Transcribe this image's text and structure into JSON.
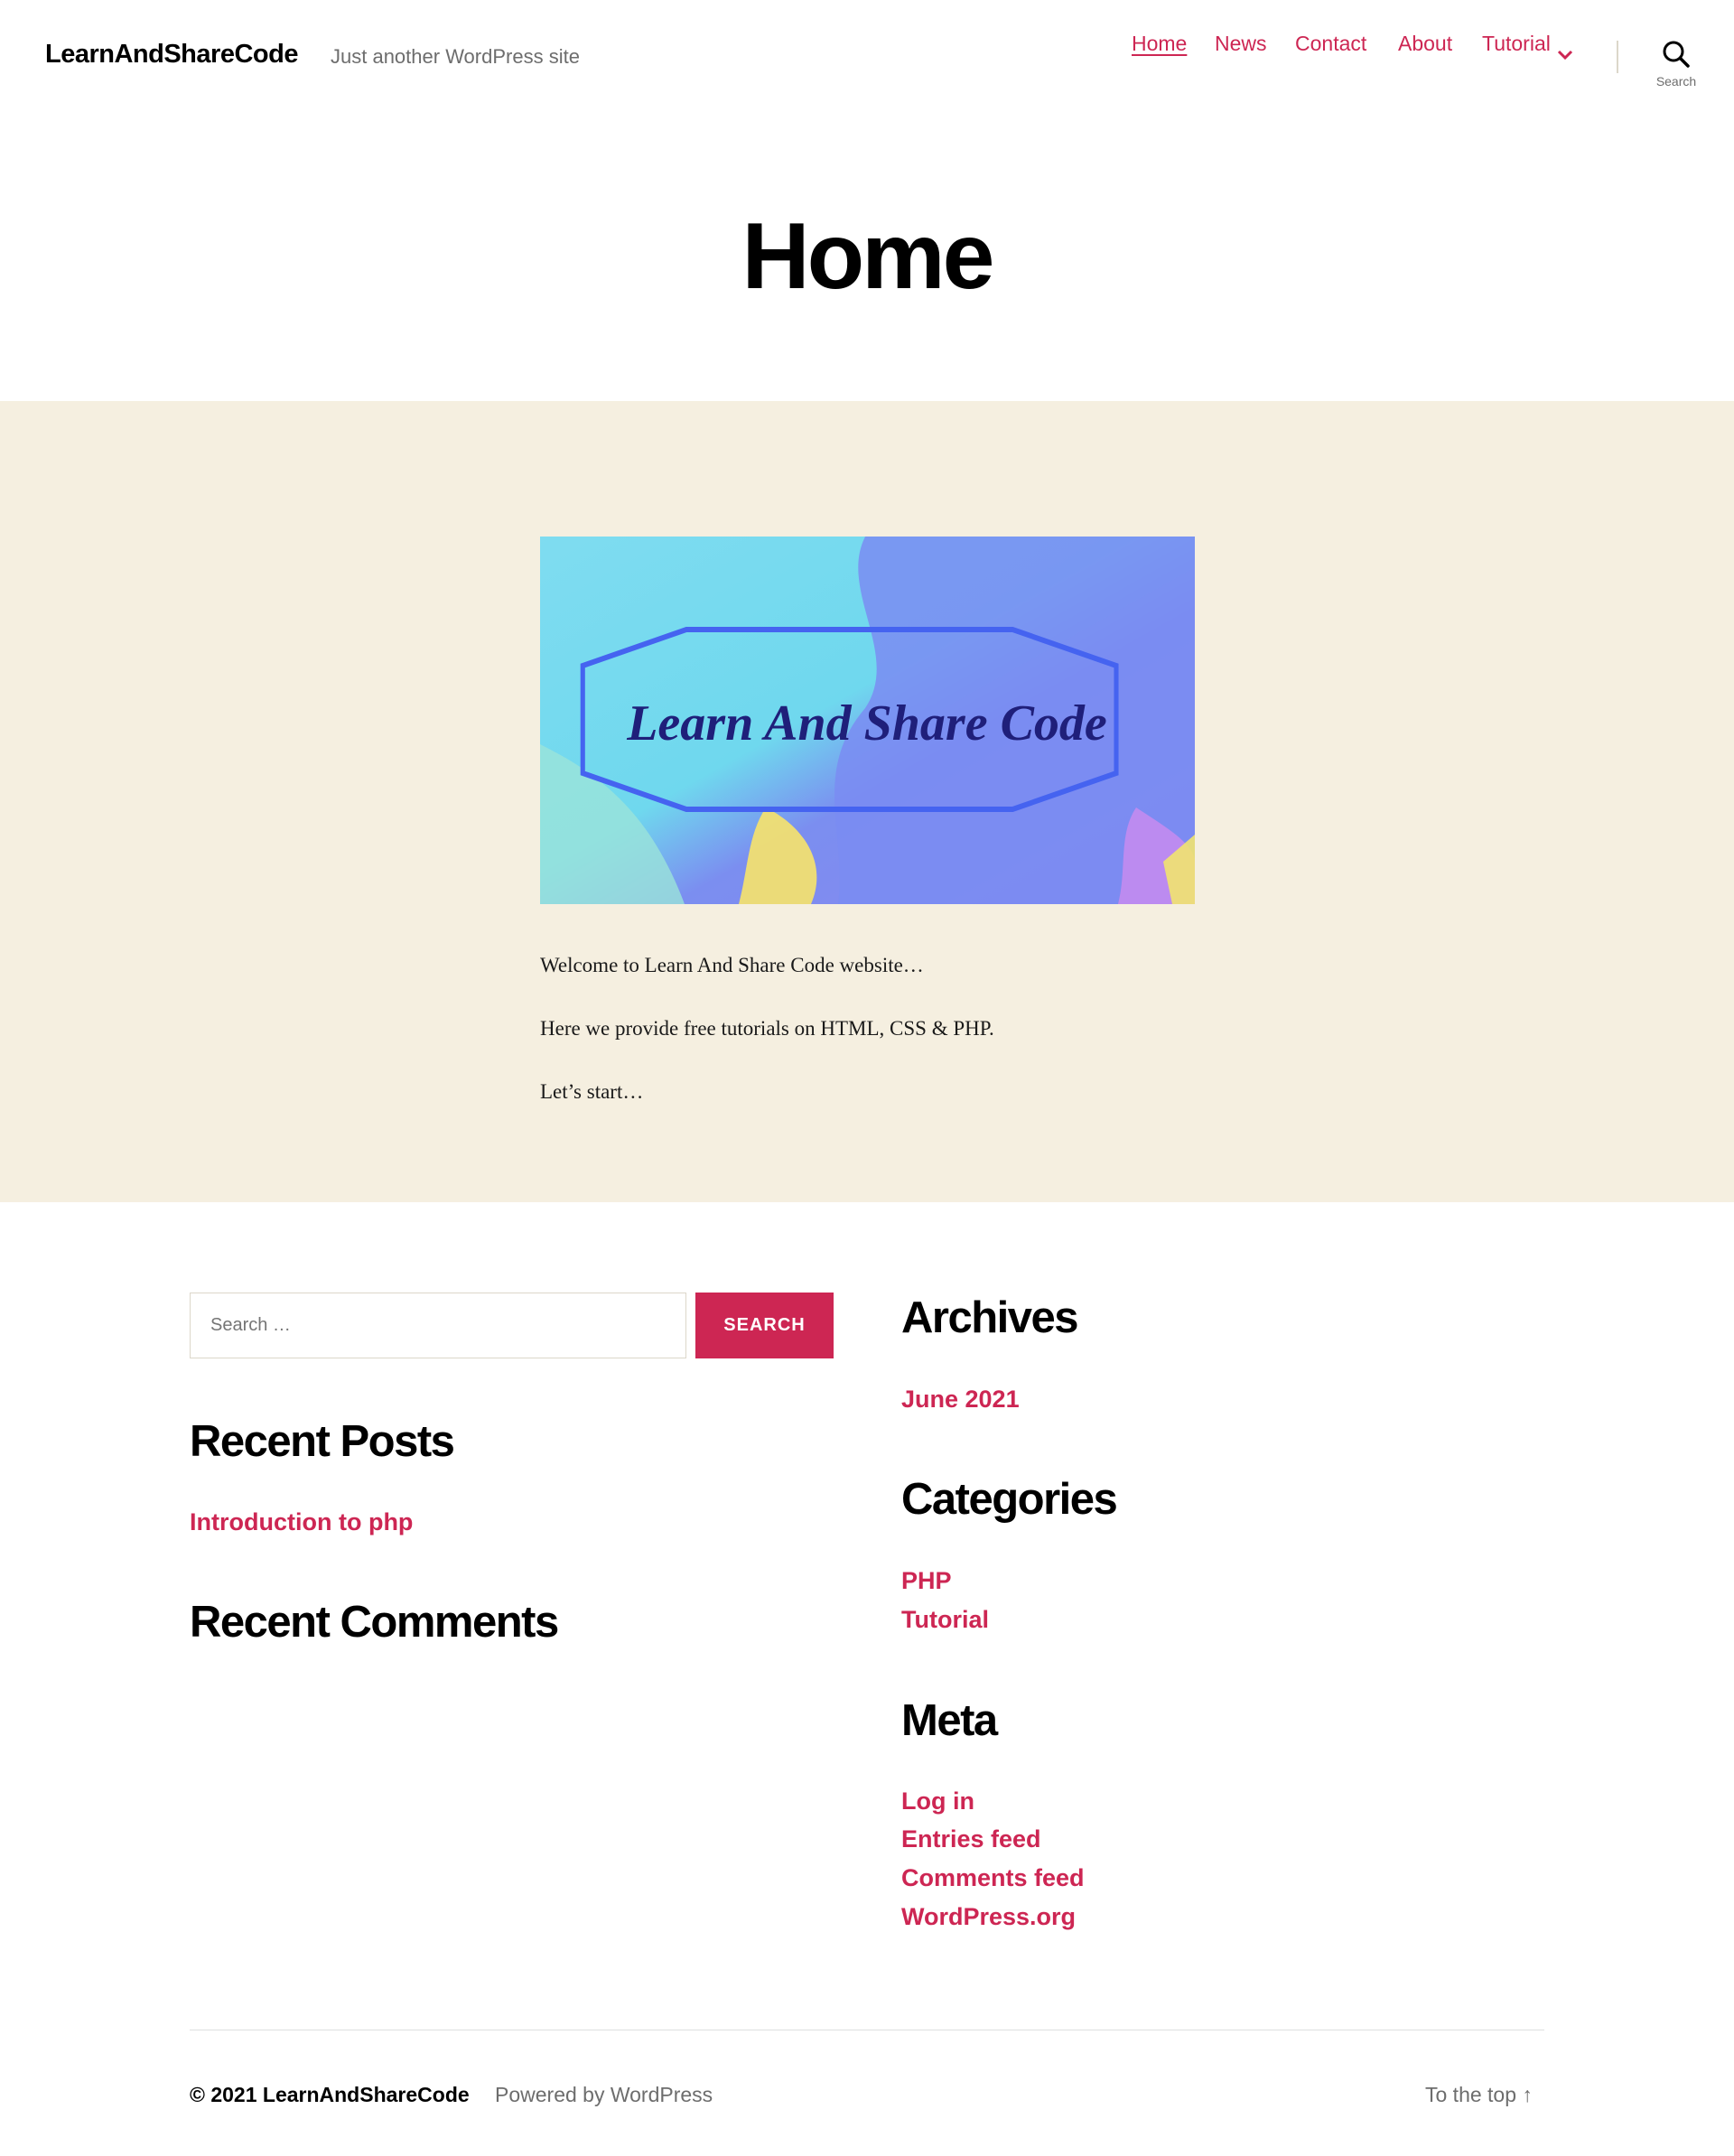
{
  "header": {
    "site_title": "LearnAndShareCode",
    "site_description": "Just another WordPress site",
    "nav": [
      {
        "label": "Home"
      },
      {
        "label": "News"
      },
      {
        "label": "Contact"
      },
      {
        "label": "About"
      },
      {
        "label": "Tutorial"
      }
    ],
    "search_label": "Search"
  },
  "page": {
    "title": "Home",
    "hero_text": "Learn And Share Code",
    "paragraphs": [
      "Welcome to Learn And Share Code website…",
      "Here we provide free tutorials on HTML, CSS & PHP.",
      "Let’s start…"
    ]
  },
  "widgets": {
    "search": {
      "placeholder": "Search …",
      "button": "SEARCH"
    },
    "recent_posts": {
      "title": "Recent Posts",
      "items": [
        "Introduction to php"
      ]
    },
    "recent_comments": {
      "title": "Recent Comments"
    },
    "archives": {
      "title": "Archives",
      "items": [
        "June 2021"
      ]
    },
    "categories": {
      "title": "Categories",
      "items": [
        "PHP",
        "Tutorial"
      ]
    },
    "meta": {
      "title": "Meta",
      "items": [
        "Log in",
        "Entries feed",
        "Comments feed",
        "WordPress.org"
      ]
    }
  },
  "footer": {
    "copyright": "© 2021 LearnAndShareCode",
    "powered": "Powered by WordPress",
    "to_top": "To the top ↑"
  },
  "colors": {
    "accent": "#cd2653",
    "band": "#f5efe0",
    "muted": "#6d6d6d"
  }
}
